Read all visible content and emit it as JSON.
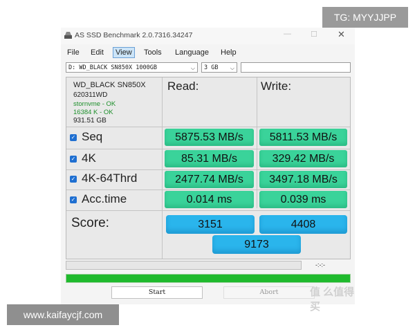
{
  "overlay": {
    "tg": "TG: MYYJJPP",
    "site": "www.kaifaycjf.com",
    "watermark": "值 么值得买"
  },
  "window": {
    "title": "AS SSD Benchmark 2.0.7316.34247"
  },
  "menu": [
    "File",
    "Edit",
    "View",
    "Tools",
    "Language",
    "Help"
  ],
  "selectors": {
    "drive": "D: WD_BLACK SN850X 1000GB",
    "size": "3 GB",
    "extra": ""
  },
  "drive_info": {
    "model": "WD_BLACK SN850X",
    "firmware": "620311WD",
    "driver": "stornvme - OK",
    "alignment": "16384 K - OK",
    "capacity": "931.51 GB"
  },
  "headers": {
    "read": "Read:",
    "write": "Write:"
  },
  "rows": [
    {
      "label": "Seq",
      "checked": true,
      "read": "5875.53 MB/s",
      "write": "5811.53 MB/s"
    },
    {
      "label": "4K",
      "checked": true,
      "read": "85.31 MB/s",
      "write": "329.42 MB/s"
    },
    {
      "label": "4K-64Thrd",
      "checked": true,
      "read": "2477.74 MB/s",
      "write": "3497.18 MB/s"
    },
    {
      "label": "Acc.time",
      "checked": true,
      "read": "0.014 ms",
      "write": "0.039 ms"
    }
  ],
  "score": {
    "label": "Score:",
    "read": "3151",
    "write": "4408",
    "total": "9173"
  },
  "progress": {
    "timer": "-:-:-",
    "completion": 1.0
  },
  "buttons": {
    "start": "Start",
    "abort": "Abort"
  },
  "colors": {
    "result_green": "#3ad39a",
    "score_blue": "#2ab5ec",
    "progress_green": "#1fba2d"
  }
}
